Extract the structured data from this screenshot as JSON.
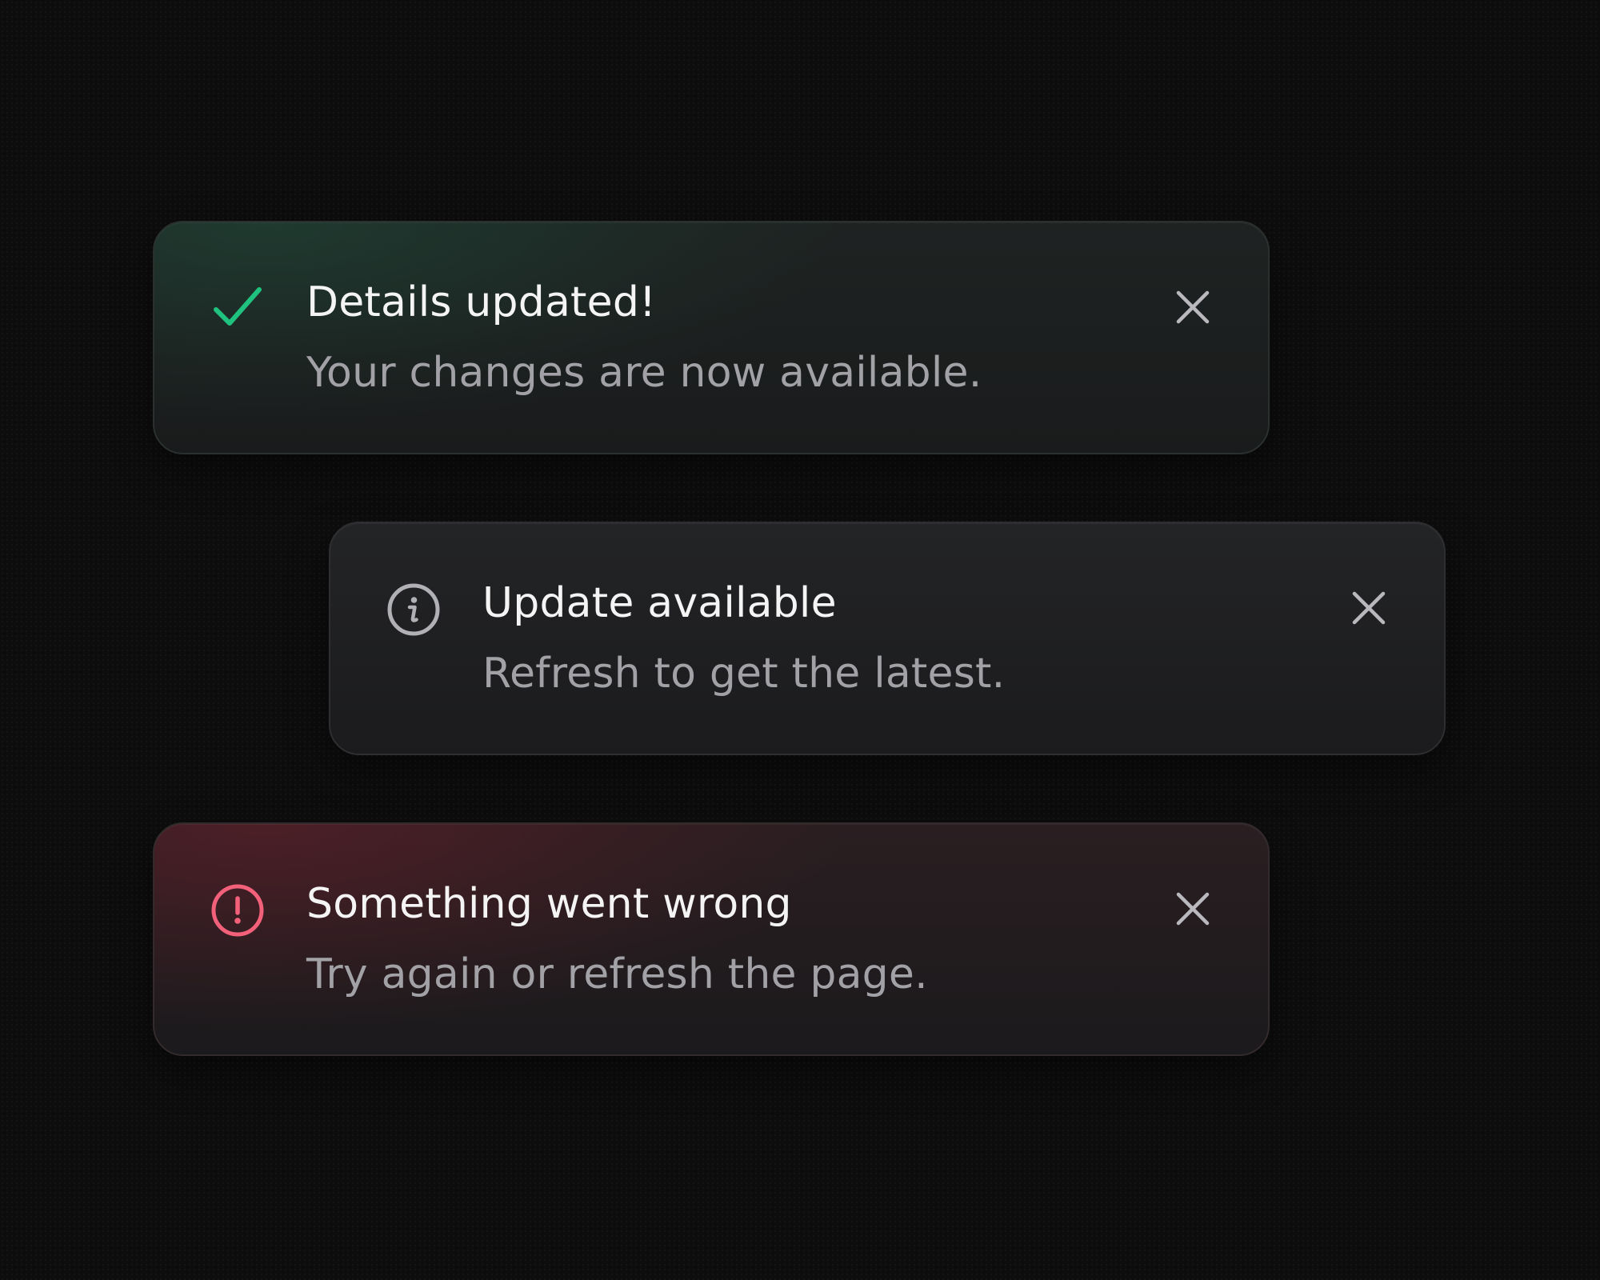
{
  "colors": {
    "background": "#0d0d0e",
    "success_accent": "#1fc27e",
    "info_accent": "#b0b0b5",
    "error_accent": "#f2607a",
    "title_text": "#f4f4f5",
    "message_text": "#a1a1a6",
    "close_icon": "#b8b8bd"
  },
  "toasts": [
    {
      "variant": "success",
      "icon": "check-icon",
      "title": "Details updated!",
      "message": "Your changes are now available.",
      "close_icon": "close-icon"
    },
    {
      "variant": "info",
      "icon": "info-circle-icon",
      "title": "Update available",
      "message": "Refresh to get the latest.",
      "close_icon": "close-icon"
    },
    {
      "variant": "error",
      "icon": "alert-circle-icon",
      "title": "Something went wrong",
      "message": "Try again or refresh the page.",
      "close_icon": "close-icon"
    }
  ]
}
